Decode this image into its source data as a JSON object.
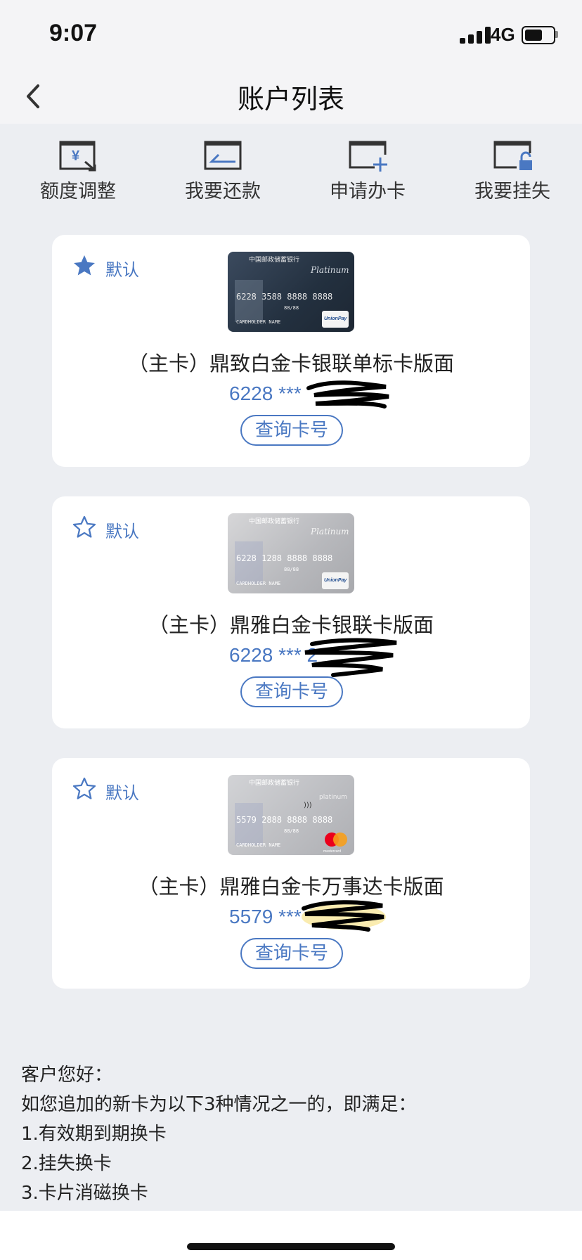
{
  "status_bar": {
    "time": "9:07",
    "network": "4G"
  },
  "nav": {
    "title": "账户列表",
    "back_icon": "chevron-left-icon"
  },
  "actions": [
    {
      "label": "额度调整",
      "icon": "limit-adjust-icon"
    },
    {
      "label": "我要还款",
      "icon": "repay-icon"
    },
    {
      "label": "申请办卡",
      "icon": "apply-card-icon"
    },
    {
      "label": "我要挂失",
      "icon": "report-loss-icon"
    }
  ],
  "cards": [
    {
      "default_label": "默认",
      "is_default": true,
      "name": "（主卡）鼎致白金卡银联单标卡版面",
      "number": "6228 ***",
      "query_label": "查询卡号",
      "card_face_number": "6228 3588 8888 8888",
      "card_face_expiry": "88/88",
      "card_face_holder": "CARDHOLDER NAME",
      "card_face_brand": "Platinum",
      "card_face_network": "UnionPay"
    },
    {
      "default_label": "默认",
      "is_default": false,
      "name": "（主卡）鼎雅白金卡银联卡版面",
      "number": "6228 *** 2",
      "query_label": "查询卡号",
      "card_face_number": "6228 1288 8888 8888",
      "card_face_expiry": "88/88",
      "card_face_holder": "CARDHOLDER NAME",
      "card_face_brand": "Platinum",
      "card_face_network": "UnionPay"
    },
    {
      "default_label": "默认",
      "is_default": false,
      "name": "（主卡）鼎雅白金卡万事达卡版面",
      "number": "5579 ***",
      "query_label": "查询卡号",
      "card_face_number": "5579 2888 8888 8888",
      "card_face_expiry": "88/88",
      "card_face_holder": "CARDHOLDER NAME",
      "card_face_brand": "platinum",
      "card_face_network": "mastercard"
    }
  ],
  "notice": {
    "greeting": "客户您好：",
    "intro": "如您追加的新卡为以下3种情况之一的，即满足：",
    "items": [
      "1.有效期到期换卡",
      "2.挂失换卡",
      "3.卡片消磁换卡"
    ]
  },
  "colors": {
    "accent": "#4a78c2",
    "background": "#eceef2",
    "card_bg": "#ffffff"
  }
}
